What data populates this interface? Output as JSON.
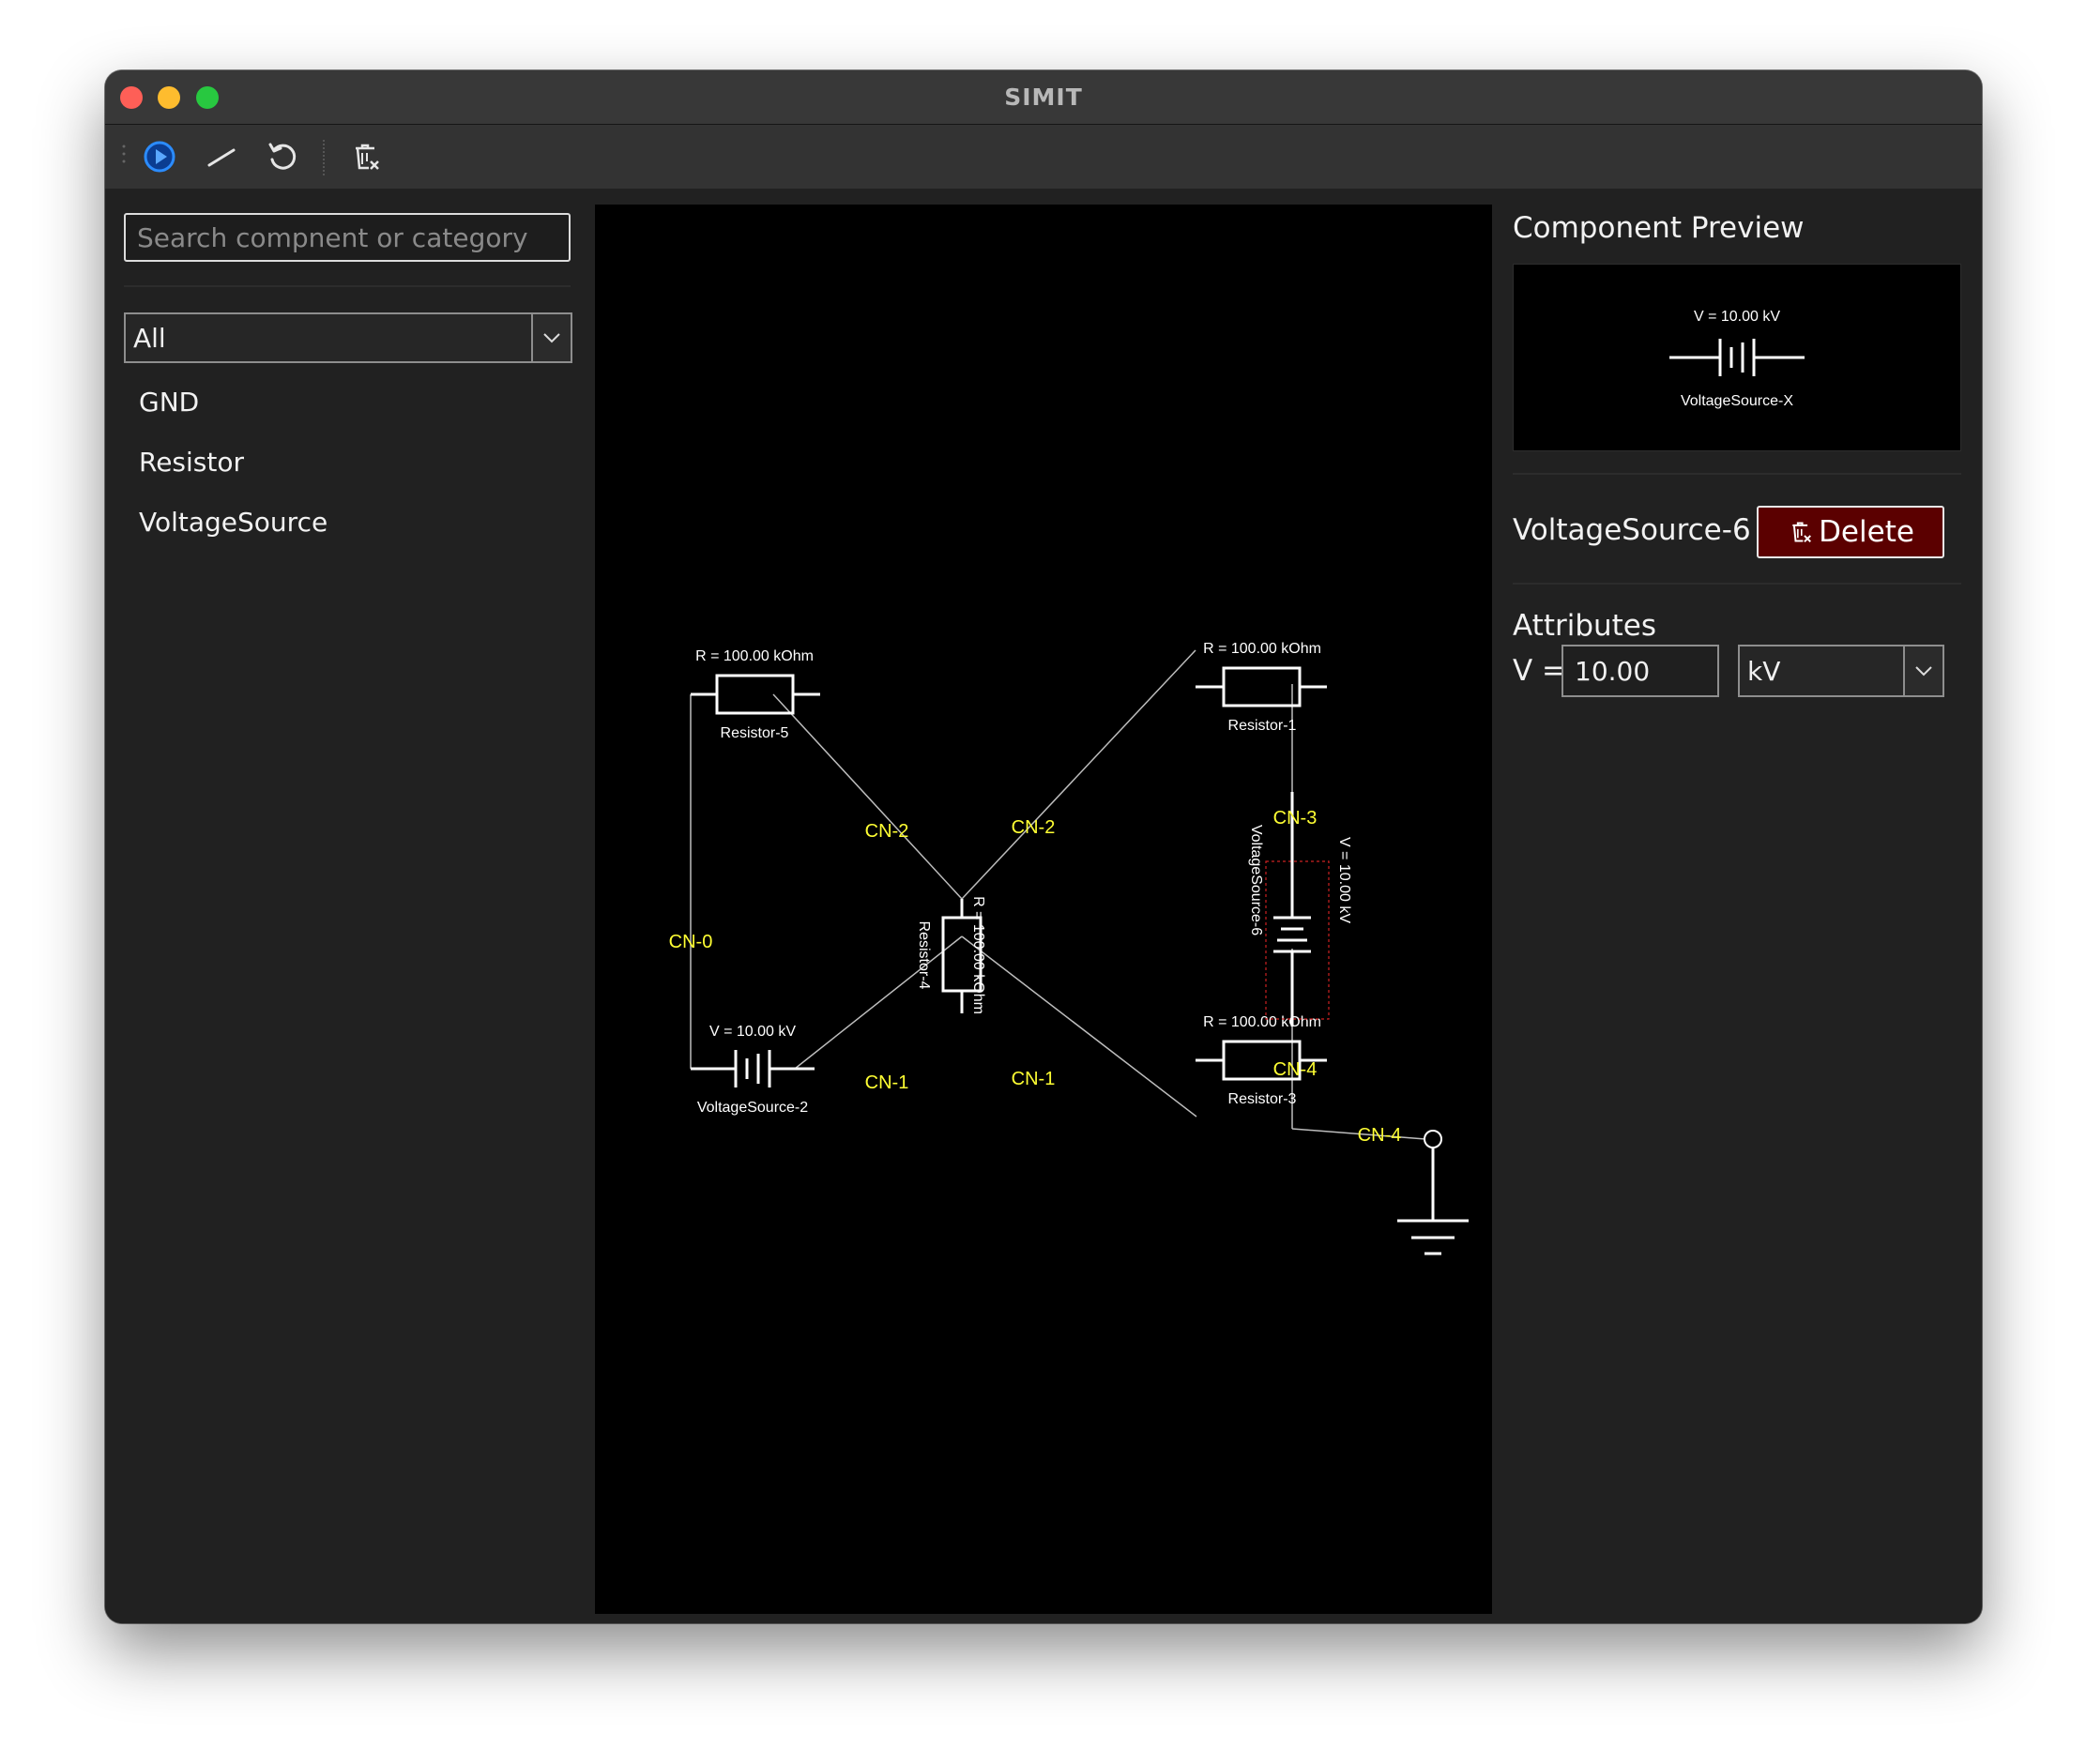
{
  "window": {
    "title": "SIMIT"
  },
  "toolbar": {
    "items": [
      {
        "name": "run",
        "icon": "play-circle-icon"
      },
      {
        "name": "wire",
        "icon": "wire-line-icon"
      },
      {
        "name": "reset",
        "icon": "refresh-icon"
      },
      {
        "name": "delete-all",
        "icon": "trash-x-icon"
      }
    ]
  },
  "left_panel": {
    "search": {
      "placeholder": "Search compnent or category",
      "value": ""
    },
    "category": {
      "selected": "All"
    },
    "components": [
      "GND",
      "Resistor",
      "VoltageSource"
    ]
  },
  "circuit": {
    "components": [
      {
        "id": "Resistor-5",
        "value": "R = 100.00 kOhm"
      },
      {
        "id": "Resistor-1",
        "value": "R = 100.00 kOhm"
      },
      {
        "id": "Resistor-4",
        "value": "R = 100.00 kOhm"
      },
      {
        "id": "Resistor-3",
        "value": "R = 100.00 kOhm"
      },
      {
        "id": "VoltageSource-2",
        "value": "V = 10.00 kV"
      },
      {
        "id": "VoltageSource-6",
        "value": "V = 10.00 kV"
      }
    ],
    "nets": [
      "CN-0",
      "CN-1",
      "CN-2",
      "CN-3",
      "CN-4"
    ],
    "colors": {
      "net_label": "#ffff33",
      "wire": "#bdbdbd",
      "symbol": "#ffffff",
      "selection": "#cc2222"
    }
  },
  "right_panel": {
    "preview_title": "Component Preview",
    "preview": {
      "value": "V = 10.00 kV",
      "name": "VoltageSource-X"
    },
    "selected_name": "VoltageSource-6",
    "delete_label": "Delete",
    "attributes_title": "Attributes",
    "attr_label": "V =",
    "attr_value": "10.00",
    "unit": "kV"
  }
}
